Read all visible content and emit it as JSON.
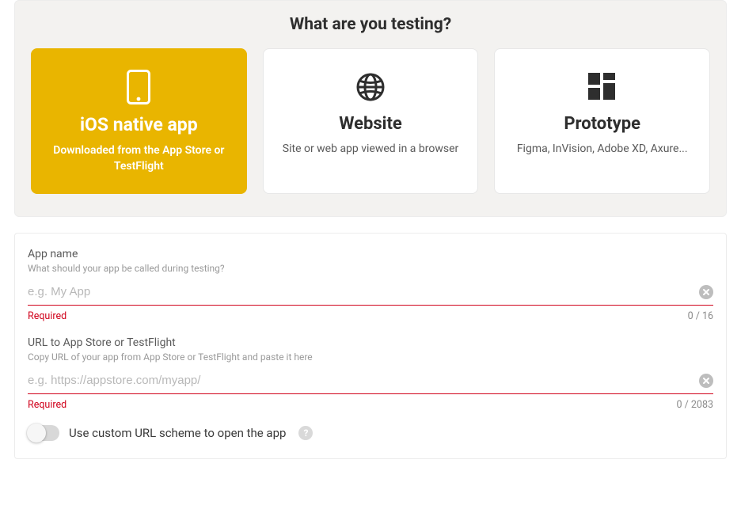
{
  "header": {
    "title": "What are you testing?"
  },
  "cards": {
    "ios": {
      "title": "iOS native app",
      "sub": "Downloaded from the App Store or TestFlight",
      "selected": true
    },
    "website": {
      "title": "Website",
      "sub": "Site or web app viewed in a browser"
    },
    "prototype": {
      "title": "Prototype",
      "sub": "Figma, InVision, Adobe XD, Axure..."
    }
  },
  "form": {
    "appName": {
      "label": "App name",
      "desc": "What should your app be called during testing?",
      "placeholder": "e.g. My App",
      "value": "",
      "error": "Required",
      "counter": "0 / 16"
    },
    "url": {
      "label": "URL to App Store or TestFlight",
      "desc": "Copy URL of your app from App Store or TestFlight and paste it here",
      "placeholder": "e.g. https://appstore.com/myapp/",
      "value": "",
      "error": "Required",
      "counter": "0 / 2083"
    },
    "toggle": {
      "label": "Use custom URL scheme to open the app",
      "on": false
    }
  },
  "colors": {
    "accent": "#e9b500",
    "error": "#d0021b"
  }
}
